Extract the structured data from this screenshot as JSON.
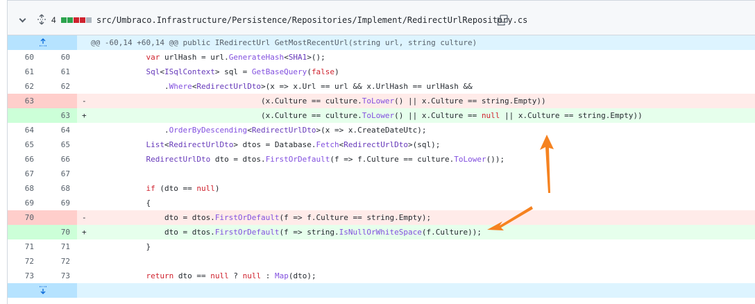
{
  "header": {
    "count": "4",
    "path": "src/Umbraco.Infrastructure/Persistence/Repositories/Implement/RedirectUrlRepository.cs",
    "stat_colors": [
      "#2da44e",
      "#2da44e",
      "#cf222e",
      "#cf222e",
      "#afb8c1"
    ]
  },
  "hunk": "@@ -60,14 +60,14 @@ public IRedirectUrl GetMostRecentUrl(string url, string culture)",
  "rows": [
    {
      "type": "ctx",
      "old": "60",
      "new": "60",
      "sign": "",
      "code": "            var urlHash = url.GenerateHash<SHA1>();"
    },
    {
      "type": "ctx",
      "old": "61",
      "new": "61",
      "sign": "",
      "code": "            Sql<ISqlContext> sql = GetBaseQuery(false)"
    },
    {
      "type": "ctx",
      "old": "62",
      "new": "62",
      "sign": "",
      "code": "                .Where<RedirectUrlDto>(x => x.Url == url && x.UrlHash == urlHash &&"
    },
    {
      "type": "del",
      "old": "63",
      "new": "",
      "sign": "-",
      "code": "                                     (x.Culture == culture.ToLower() || x.Culture == string.Empty))"
    },
    {
      "type": "add",
      "old": "",
      "new": "63",
      "sign": "+",
      "code": "                                     (x.Culture == culture.ToLower() || x.Culture == null || x.Culture == string.Empty))"
    },
    {
      "type": "ctx",
      "old": "64",
      "new": "64",
      "sign": "",
      "code": "                .OrderByDescending<RedirectUrlDto>(x => x.CreateDateUtc);"
    },
    {
      "type": "ctx",
      "old": "65",
      "new": "65",
      "sign": "",
      "code": "            List<RedirectUrlDto> dtos = Database.Fetch<RedirectUrlDto>(sql);"
    },
    {
      "type": "ctx",
      "old": "66",
      "new": "66",
      "sign": "",
      "code": "            RedirectUrlDto dto = dtos.FirstOrDefault(f => f.Culture == culture.ToLower());"
    },
    {
      "type": "ctx",
      "old": "67",
      "new": "67",
      "sign": "",
      "code": ""
    },
    {
      "type": "ctx",
      "old": "68",
      "new": "68",
      "sign": "",
      "code": "            if (dto == null)"
    },
    {
      "type": "ctx",
      "old": "69",
      "new": "69",
      "sign": "",
      "code": "            {"
    },
    {
      "type": "del",
      "old": "70",
      "new": "",
      "sign": "-",
      "code": "                dto = dtos.FirstOrDefault(f => f.Culture == string.Empty);"
    },
    {
      "type": "add",
      "old": "",
      "new": "70",
      "sign": "+",
      "code": "                dto = dtos.FirstOrDefault(f => string.IsNullOrWhiteSpace(f.Culture));"
    },
    {
      "type": "ctx",
      "old": "71",
      "new": "71",
      "sign": "",
      "code": "            }"
    },
    {
      "type": "ctx",
      "old": "72",
      "new": "72",
      "sign": "",
      "code": ""
    },
    {
      "type": "ctx",
      "old": "73",
      "new": "73",
      "sign": "",
      "code": "            return dto == null ? null : Map(dto);"
    }
  ],
  "icons": {
    "collapse": "chevron-down-icon",
    "expand_all": "unfold-icon",
    "copy": "copy-icon",
    "expand_up": "expand-up-icon",
    "expand_down": "expand-down-icon"
  },
  "accent": {
    "arrow": "#f58220"
  }
}
